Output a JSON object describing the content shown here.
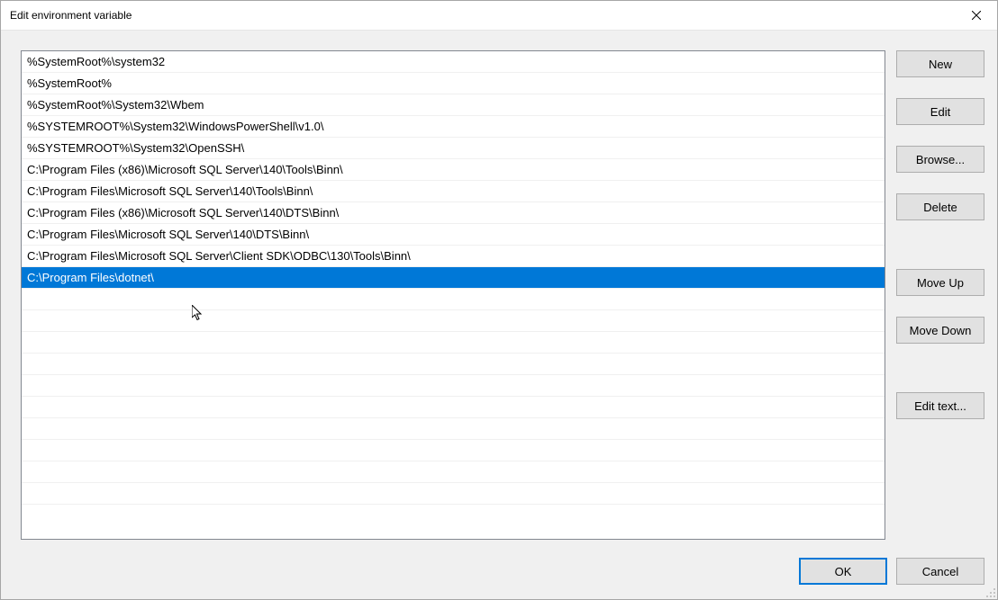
{
  "window": {
    "title": "Edit environment variable"
  },
  "paths": [
    "%SystemRoot%\\system32",
    "%SystemRoot%",
    "%SystemRoot%\\System32\\Wbem",
    "%SYSTEMROOT%\\System32\\WindowsPowerShell\\v1.0\\",
    "%SYSTEMROOT%\\System32\\OpenSSH\\",
    "C:\\Program Files (x86)\\Microsoft SQL Server\\140\\Tools\\Binn\\",
    "C:\\Program Files\\Microsoft SQL Server\\140\\Tools\\Binn\\",
    "C:\\Program Files (x86)\\Microsoft SQL Server\\140\\DTS\\Binn\\",
    "C:\\Program Files\\Microsoft SQL Server\\140\\DTS\\Binn\\",
    "C:\\Program Files\\Microsoft SQL Server\\Client SDK\\ODBC\\130\\Tools\\Binn\\",
    "C:\\Program Files\\dotnet\\"
  ],
  "selected_index": 10,
  "buttons": {
    "new": "New",
    "edit": "Edit",
    "browse": "Browse...",
    "delete": "Delete",
    "move_up": "Move Up",
    "move_down": "Move Down",
    "edit_text": "Edit text...",
    "ok": "OK",
    "cancel": "Cancel"
  }
}
